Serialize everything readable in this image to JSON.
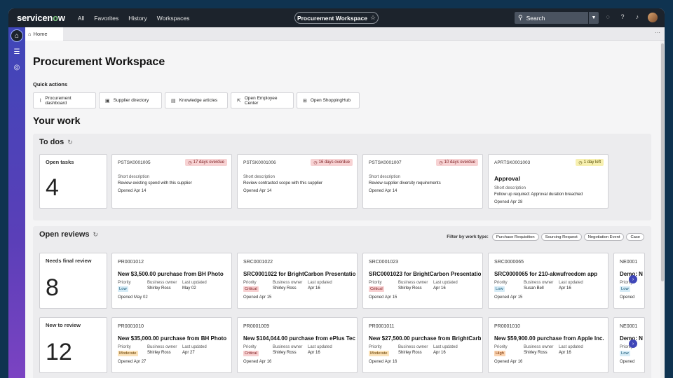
{
  "topbar": {
    "logo_prefix": "servicen",
    "logo_o": "o",
    "logo_suffix": "w",
    "nav": [
      "All",
      "Favorites",
      "History",
      "Workspaces"
    ],
    "workspace": "Procurement Workspace",
    "search_placeholder": "Search"
  },
  "tabs": [
    {
      "label": "Home"
    }
  ],
  "page": {
    "title": "Procurement Workspace",
    "quick_actions_label": "Quick actions",
    "quick_actions": [
      {
        "label": "Procurement dashboard",
        "icon": "chart-icon"
      },
      {
        "label": "Supplier directory",
        "icon": "briefcase-icon"
      },
      {
        "label": "Knowledge articles",
        "icon": "book-icon"
      },
      {
        "label": "Open Employee Center",
        "icon": "external-link-icon"
      },
      {
        "label": "Open ShoppingHub",
        "icon": "cart-icon"
      }
    ],
    "your_work": "Your work"
  },
  "todos": {
    "title": "To dos",
    "open_tasks_label": "Open tasks",
    "open_tasks_count": "4",
    "tasks": [
      {
        "number": "PSTSK0001005",
        "badge": "17 days overdue",
        "badge_type": "red",
        "title": "",
        "sd_label": "Short description",
        "sd": "Review existing spend with this supplier",
        "opened": "Opened Apr 14"
      },
      {
        "number": "PSTSK0001006",
        "badge": "16 days overdue",
        "badge_type": "red",
        "title": "",
        "sd_label": "Short description",
        "sd": "Review contracted scope with this supplier",
        "opened": "Opened Apr 14"
      },
      {
        "number": "PSTSK0001007",
        "badge": "10 days overdue",
        "badge_type": "red",
        "title": "",
        "sd_label": "Short description",
        "sd": "Review supplier diversity requirements",
        "opened": "Opened Apr 14"
      },
      {
        "number": "APRTSK0001003",
        "badge": "1 day left",
        "badge_type": "yellow",
        "title": "Approval",
        "sd_label": "Short description",
        "sd": "Follow up required: Approval duration breached",
        "opened": "Opened Apr 28"
      }
    ]
  },
  "reviews": {
    "title": "Open reviews",
    "filter_label": "Filter by work type:",
    "filters": [
      "Purchase Requisition",
      "Sourcing Request",
      "Negotiation Event",
      "Case"
    ],
    "col_priority": "Priority",
    "col_owner": "Business owner",
    "col_updated": "Last updated",
    "rows": [
      {
        "label": "Needs final review",
        "count": "8",
        "cards": [
          {
            "number": "PR0001012",
            "title": "New $3,500.00 purchase from BH Photo",
            "priority": "Low",
            "pclass": "low",
            "owner": "Shirley Ross",
            "updated": "May 02",
            "opened": "Opened May 02"
          },
          {
            "number": "SRC0001022",
            "title": "SRC0001022 for BrightCarbon Presentations",
            "priority": "Critical",
            "pclass": "critical",
            "owner": "Shirley Ross",
            "updated": "Apr 16",
            "opened": "Opened Apr 15"
          },
          {
            "number": "SRC0001023",
            "title": "SRC0001023 for BrightCarbon Presentations",
            "priority": "Critical",
            "pclass": "critical",
            "owner": "Shirley Ross",
            "updated": "Apr 16",
            "opened": "Opened Apr 15"
          },
          {
            "number": "SRC0000065",
            "title": "SRC0000065 for 210-akwufreedom app",
            "priority": "Low",
            "pclass": "low",
            "owner": "Susan Bell",
            "updated": "Apr 16",
            "opened": "Opened Apr 15"
          },
          {
            "number": "NE0001",
            "title": "Demo: N",
            "priority": "Low",
            "pclass": "low",
            "owner": "",
            "updated": "",
            "opened": "Opened"
          }
        ]
      },
      {
        "label": "New to review",
        "count": "12",
        "cards": [
          {
            "number": "PR0001010",
            "title": "New $35,000.00 purchase from BH Photo",
            "priority": "Moderate",
            "pclass": "moderate",
            "owner": "Shirley Ross",
            "updated": "Apr 27",
            "opened": "Opened Apr 27"
          },
          {
            "number": "PR0001009",
            "title": "New $104,044.00 purchase from ePlus Technology",
            "priority": "Critical",
            "pclass": "critical",
            "owner": "Shirley Ross",
            "updated": "Apr 16",
            "opened": "Opened Apr 16"
          },
          {
            "number": "PR0001011",
            "title": "New $27,500.00 purchase from BrightCarbon",
            "priority": "Moderate",
            "pclass": "moderate",
            "owner": "Shirley Ross",
            "updated": "Apr 16",
            "opened": "Opened Apr 16"
          },
          {
            "number": "PR0001010",
            "title": "New $59,900.00 purchase from Apple Inc.",
            "priority": "High",
            "pclass": "high",
            "owner": "Shirley Ross",
            "updated": "Apr 16",
            "opened": "Opened Apr 16"
          },
          {
            "number": "NE0001",
            "title": "Demo: N",
            "priority": "Low",
            "pclass": "low",
            "owner": "",
            "updated": "",
            "opened": "Opened"
          }
        ]
      }
    ]
  }
}
